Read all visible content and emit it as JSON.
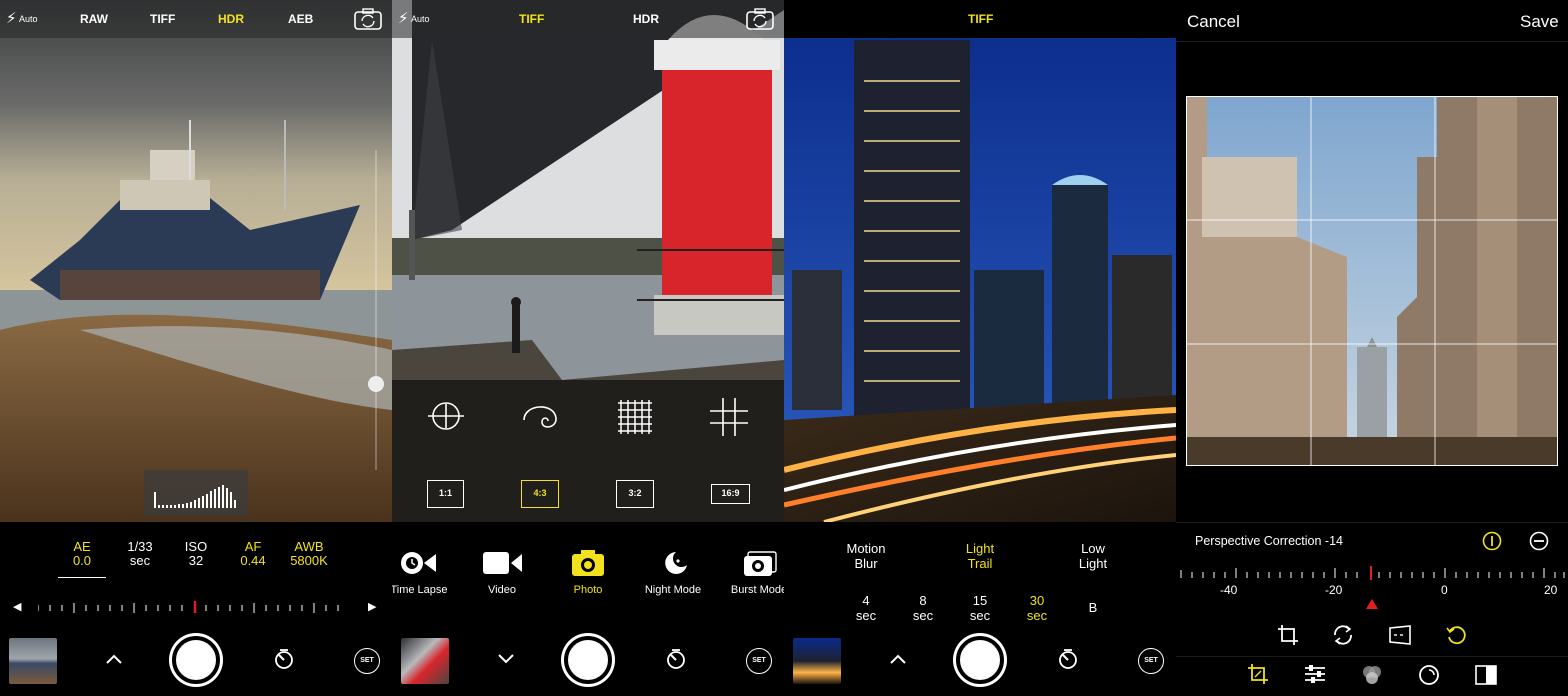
{
  "colors": {
    "accent": "#f1e21b",
    "background": "#000000",
    "indicator": "#e02020"
  },
  "panel1": {
    "topbar": {
      "flash_mode": "Auto",
      "formats": [
        "RAW",
        "TIFF",
        "HDR",
        "AEB"
      ],
      "selected_format": "HDR",
      "flip_icon": "camera-flip-icon"
    },
    "settings": [
      {
        "name": "AE",
        "value": "0.0",
        "active": true
      },
      {
        "name": "1/33",
        "value": "sec",
        "active": false
      },
      {
        "name": "ISO",
        "value": "32",
        "active": false
      },
      {
        "name": "AF",
        "value": "0.44",
        "active": true
      },
      {
        "name": "AWB",
        "value": "5800K",
        "active": true
      }
    ],
    "controls": {
      "left_arrow": "◀",
      "right_arrow": "▶",
      "expand_icon": "chevron-up-icon",
      "set_label": "SET"
    }
  },
  "panel2": {
    "topbar": {
      "flash_mode": "Auto",
      "formats": [
        "TIFF",
        "HDR"
      ],
      "selected_format": "TIFF"
    },
    "grid_overlays": [
      "crosshair-grid-icon",
      "spiral-grid-icon",
      "dense-grid-icon",
      "thirds-grid-icon"
    ],
    "aspect_ratios": [
      "1:1",
      "4:3",
      "3:2",
      "16:9"
    ],
    "selected_ratio": "4:3",
    "modes": [
      "Time Lapse",
      "Video",
      "Photo",
      "Night Mode",
      "Burst Mode"
    ],
    "selected_mode": "Photo",
    "controls": {
      "collapse_icon": "chevron-down-icon",
      "set_label": "SET"
    }
  },
  "panel3": {
    "topbar": {
      "selected_format": "TIFF"
    },
    "modes": [
      {
        "line1": "Motion",
        "line2": "Blur",
        "active": false
      },
      {
        "line1": "Light",
        "line2": "Trail",
        "active": true
      },
      {
        "line1": "Low",
        "line2": "Light",
        "active": false
      }
    ],
    "durations": [
      {
        "line1": "4",
        "line2": "sec",
        "active": false
      },
      {
        "line1": "8",
        "line2": "sec",
        "active": false
      },
      {
        "line1": "15",
        "line2": "sec",
        "active": false
      },
      {
        "line1": "30",
        "line2": "sec",
        "active": true
      },
      {
        "line1": "B",
        "line2": "",
        "active": false
      }
    ],
    "controls": {
      "expand_icon": "chevron-up-icon",
      "set_label": "SET"
    }
  },
  "panel4": {
    "cancel_label": "Cancel",
    "save_label": "Save",
    "correction_label": "Perspective Correction -14",
    "correction_value": -14,
    "scale_labels": [
      "-40",
      "-20",
      "0",
      "20"
    ],
    "edit_tools": [
      "crop-icon",
      "rotate-icon",
      "perspective-icon",
      "reset-icon"
    ],
    "bottom_tabs": [
      "crop-tab-icon",
      "adjust-tab-icon",
      "filters-tab-icon",
      "vignette-tab-icon",
      "compare-tab-icon"
    ]
  }
}
